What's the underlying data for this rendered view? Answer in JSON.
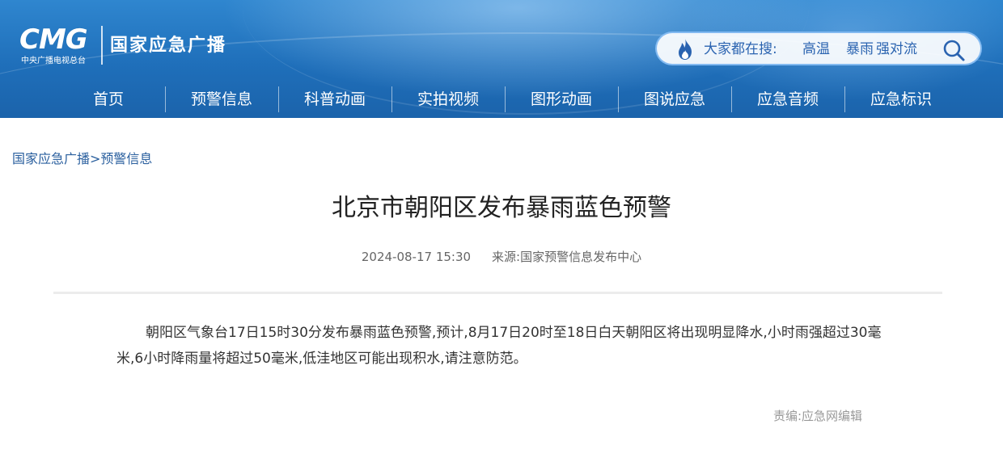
{
  "header": {
    "logo": {
      "cmg_text": "CMG",
      "subtitle": "中央广播电视总台",
      "site_name": "国家应急广播"
    },
    "search": {
      "label": "大家都在搜:",
      "keywords": [
        "高温",
        "暴雨",
        "强对流"
      ],
      "icon": "search-icon",
      "flame_icon": "flame-icon",
      "accent_color": "#2a63b0"
    },
    "nav": [
      {
        "label": "首页"
      },
      {
        "label": "预警信息"
      },
      {
        "label": "科普动画"
      },
      {
        "label": "实拍视频"
      },
      {
        "label": "图形动画"
      },
      {
        "label": "图说应急"
      },
      {
        "label": "应急音频"
      },
      {
        "label": "应急标识"
      }
    ],
    "bg_color": "#1f6fba"
  },
  "breadcrumb": {
    "items": [
      "国家应急广播",
      "预警信息"
    ],
    "separator": ">"
  },
  "article": {
    "title": "北京市朝阳区发布暴雨蓝色预警",
    "datetime": "2024-08-17 15:30",
    "source": "来源:国家预警信息发布中心",
    "body": "朝阳区气象台17日15时30分发布暴雨蓝色预警,预计,8月17日20时至18日白天朝阳区将出现明显降水,小时雨强超过30毫米,6小时降雨量将超过50毫米,低洼地区可能出现积水,请注意防范。",
    "editor": "责编:应急网编辑"
  }
}
